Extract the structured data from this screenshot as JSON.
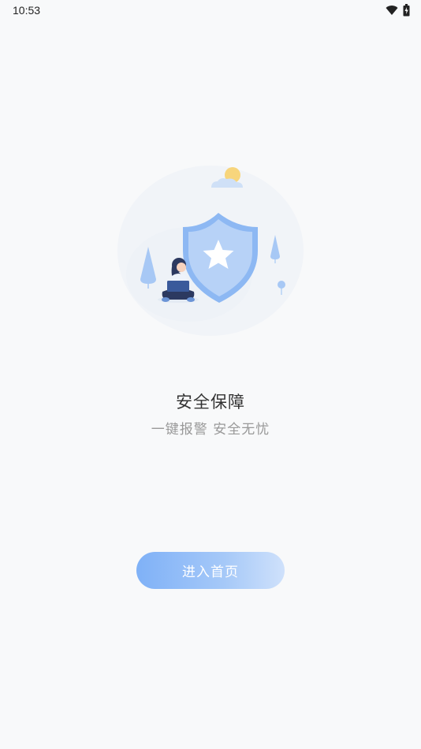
{
  "status_bar": {
    "time": "10:53",
    "icons": [
      "wifi-icon",
      "battery-charging-icon"
    ]
  },
  "main": {
    "title": "安全保障",
    "subtitle": "一键报警 安全无忧",
    "illustration": "shield-star-illustration"
  },
  "actions": {
    "enter_label": "进入首页"
  },
  "colors": {
    "background": "#f8f9fa",
    "accent": "#7fb1f7",
    "shield": "#8db8f3",
    "sun": "#f7d57c"
  }
}
